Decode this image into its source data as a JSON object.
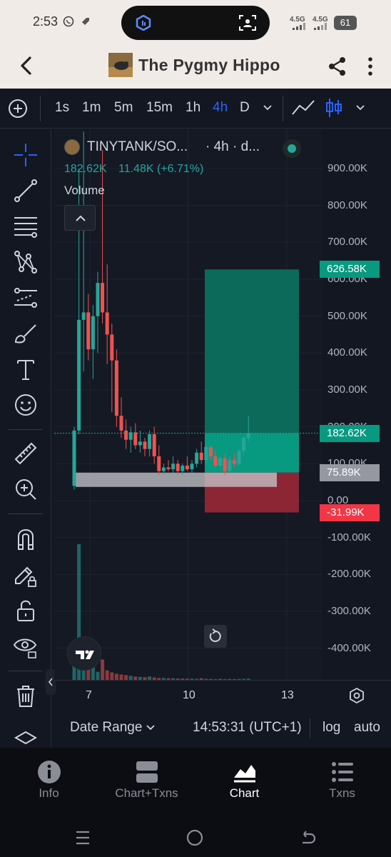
{
  "status_bar": {
    "time": "2:53",
    "signal_1": "4.5G",
    "signal_2": "4.5G",
    "battery": "61"
  },
  "app_bar": {
    "title": "The Pygmy Hippo",
    "back_icon": "chevron-left-icon",
    "share_icon": "share-icon",
    "menu_icon": "more-vertical-icon"
  },
  "toolbar": {
    "timeframes": [
      "1s",
      "1m",
      "5m",
      "15m",
      "1h",
      "4h",
      "D"
    ],
    "active_timeframe": "4h"
  },
  "legend": {
    "symbol": "TINYTANK/SO...",
    "interval": "· 4h · d...",
    "price": "182.62K",
    "change": "11.48K (+6.71%)",
    "volume_label": "Volume",
    "up_color": "#26a69a",
    "down_color": "#ef5350"
  },
  "price_axis": {
    "labels": [
      "900.00K",
      "800.00K",
      "700.00K",
      "600.00K",
      "500.00K",
      "400.00K",
      "300.00K",
      "200.00K",
      "100.00K",
      "0.00",
      "-100.00K",
      "-200.00K",
      "-300.00K",
      "-400.00K"
    ],
    "badges": {
      "target": "626.58K",
      "current": "182.62K",
      "entry": "75.89K",
      "stop": "-31.99K"
    },
    "target_color": "#089981",
    "stop_color": "#f23645",
    "entry_color": "#868993"
  },
  "time_axis": {
    "labels": [
      "7",
      "10",
      "13"
    ]
  },
  "bottom_bar": {
    "date_range": "Date Range",
    "clock": "14:53:31 (UTC+1)",
    "log": "log",
    "auto": "auto"
  },
  "bottom_nav": [
    {
      "label": "Info",
      "icon": "info-icon"
    },
    {
      "label": "Chart+Txns",
      "icon": "split-view-icon"
    },
    {
      "label": "Chart",
      "icon": "chart-icon",
      "active": true
    },
    {
      "label": "Txns",
      "icon": "list-icon"
    }
  ],
  "chart_data": {
    "type": "candlestick",
    "symbol": "TINYTANK/SO...",
    "interval": "4h",
    "x_ticks": [
      "7",
      "10",
      "13"
    ],
    "ylim": [
      -450000,
      950000
    ],
    "candles": [
      {
        "o": 40000,
        "h": 200000,
        "l": 30000,
        "c": 190000
      },
      {
        "o": 190000,
        "h": 900000,
        "l": 180000,
        "c": 490000
      },
      {
        "o": 490000,
        "h": 1000000,
        "l": 350000,
        "c": 510000
      },
      {
        "o": 510000,
        "h": 560000,
        "l": 380000,
        "c": 410000
      },
      {
        "o": 410000,
        "h": 530000,
        "l": 330000,
        "c": 500000
      },
      {
        "o": 500000,
        "h": 620000,
        "l": 400000,
        "c": 590000
      },
      {
        "o": 590000,
        "h": 950000,
        "l": 480000,
        "c": 510000
      },
      {
        "o": 510000,
        "h": 640000,
        "l": 370000,
        "c": 450000
      },
      {
        "o": 450000,
        "h": 480000,
        "l": 240000,
        "c": 380000
      },
      {
        "o": 380000,
        "h": 410000,
        "l": 200000,
        "c": 230000
      },
      {
        "o": 230000,
        "h": 280000,
        "l": 170000,
        "c": 190000
      },
      {
        "o": 190000,
        "h": 220000,
        "l": 140000,
        "c": 165000
      },
      {
        "o": 165000,
        "h": 200000,
        "l": 130000,
        "c": 185000
      },
      {
        "o": 185000,
        "h": 210000,
        "l": 140000,
        "c": 150000
      },
      {
        "o": 150000,
        "h": 190000,
        "l": 130000,
        "c": 160000
      },
      {
        "o": 160000,
        "h": 170000,
        "l": 120000,
        "c": 140000
      },
      {
        "o": 140000,
        "h": 190000,
        "l": 120000,
        "c": 180000
      },
      {
        "o": 180000,
        "h": 200000,
        "l": 100000,
        "c": 120000
      },
      {
        "o": 120000,
        "h": 150000,
        "l": 70000,
        "c": 80000
      },
      {
        "o": 80000,
        "h": 100000,
        "l": 70000,
        "c": 90000
      },
      {
        "o": 90000,
        "h": 110000,
        "l": 80000,
        "c": 85000
      },
      {
        "o": 85000,
        "h": 120000,
        "l": 75000,
        "c": 100000
      },
      {
        "o": 100000,
        "h": 110000,
        "l": 70000,
        "c": 80000
      },
      {
        "o": 80000,
        "h": 100000,
        "l": 70000,
        "c": 95000
      },
      {
        "o": 95000,
        "h": 120000,
        "l": 80000,
        "c": 85000
      },
      {
        "o": 85000,
        "h": 110000,
        "l": 75000,
        "c": 100000
      },
      {
        "o": 100000,
        "h": 140000,
        "l": 90000,
        "c": 130000
      },
      {
        "o": 130000,
        "h": 160000,
        "l": 100000,
        "c": 110000
      },
      {
        "o": 110000,
        "h": 150000,
        "l": 100000,
        "c": 145000
      },
      {
        "o": 145000,
        "h": 150000,
        "l": 110000,
        "c": 120000
      },
      {
        "o": 120000,
        "h": 135000,
        "l": 90000,
        "c": 95000
      },
      {
        "o": 95000,
        "h": 120000,
        "l": 85000,
        "c": 115000
      },
      {
        "o": 115000,
        "h": 125000,
        "l": 70000,
        "c": 80000
      },
      {
        "o": 80000,
        "h": 120000,
        "l": 75000,
        "c": 110000
      },
      {
        "o": 110000,
        "h": 130000,
        "l": 90000,
        "c": 100000
      },
      {
        "o": 100000,
        "h": 140000,
        "l": 95000,
        "c": 135000
      },
      {
        "o": 135000,
        "h": 175000,
        "l": 120000,
        "c": 170000
      },
      {
        "o": 170000,
        "h": 230000,
        "l": 160000,
        "c": 182620
      }
    ],
    "volume": [
      180,
      1000,
      120,
      90,
      230,
      60,
      150,
      70,
      55,
      45,
      40,
      35,
      30,
      25,
      22,
      20,
      25,
      18,
      15,
      14,
      12,
      12,
      10,
      10,
      9,
      9,
      8,
      12,
      8,
      7,
      6,
      8,
      6,
      7,
      6,
      7,
      8,
      9
    ],
    "position": {
      "target": 626580,
      "entry": 75890,
      "stop": -31990,
      "current": 182620
    }
  }
}
